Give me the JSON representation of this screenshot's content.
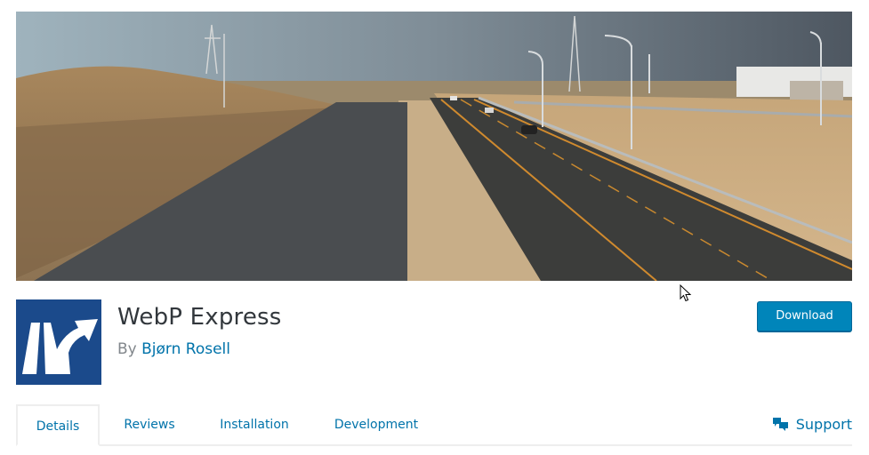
{
  "banner": {
    "alt": "Highway under construction banner",
    "colors": {
      "sky": "#6d7c88",
      "earth": "#a58b65",
      "asphalt": "#3e3f3e",
      "lane_line": "#d08a2e"
    }
  },
  "plugin": {
    "title": "WebP Express",
    "author_prefix": "By",
    "author_name": "Bjørn Rosell",
    "icon": "road-fork-arrow-icon",
    "icon_bg": "#1b4a8b"
  },
  "actions": {
    "download_label": "Download"
  },
  "tabs": [
    {
      "label": "Details",
      "active": true
    },
    {
      "label": "Reviews",
      "active": false
    },
    {
      "label": "Installation",
      "active": false
    },
    {
      "label": "Development",
      "active": false
    }
  ],
  "support": {
    "label": "Support",
    "icon": "speech-bubbles-icon"
  },
  "colors": {
    "link": "#0073aa",
    "button": "#0085ba",
    "title": "#32373c",
    "muted": "#82878c"
  }
}
